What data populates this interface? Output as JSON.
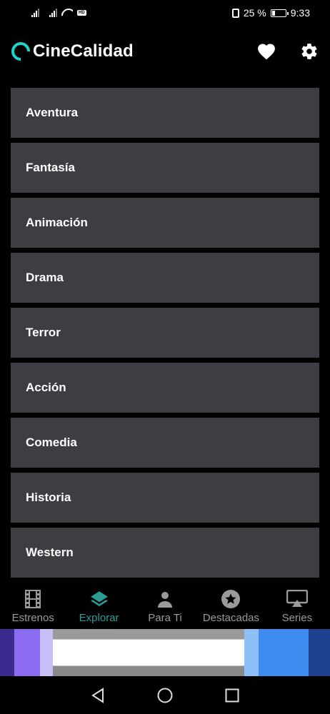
{
  "status_bar": {
    "battery": "25 %",
    "time": "9:33",
    "battery_level": 0.25
  },
  "app": {
    "title": "CineCalidad",
    "accent_color": "#1ed3c9"
  },
  "genres": [
    {
      "label": "Aventura"
    },
    {
      "label": "Fantasía"
    },
    {
      "label": "Animación"
    },
    {
      "label": "Drama"
    },
    {
      "label": "Terror"
    },
    {
      "label": "Acción"
    },
    {
      "label": "Comedia"
    },
    {
      "label": "Historia"
    },
    {
      "label": "Western"
    }
  ],
  "bottom_nav": {
    "active_color": "#2a9d96",
    "items": [
      {
        "label": "Estrenos",
        "icon": "film-icon"
      },
      {
        "label": "Explorar",
        "icon": "layers-icon",
        "active": true
      },
      {
        "label": "Para Ti",
        "icon": "person-icon"
      },
      {
        "label": "Destacadas",
        "icon": "star-circle-icon"
      },
      {
        "label": "Series",
        "icon": "airplay-icon"
      }
    ]
  },
  "system_nav": {
    "buttons": [
      "back-icon",
      "home-icon",
      "recents-icon"
    ]
  }
}
